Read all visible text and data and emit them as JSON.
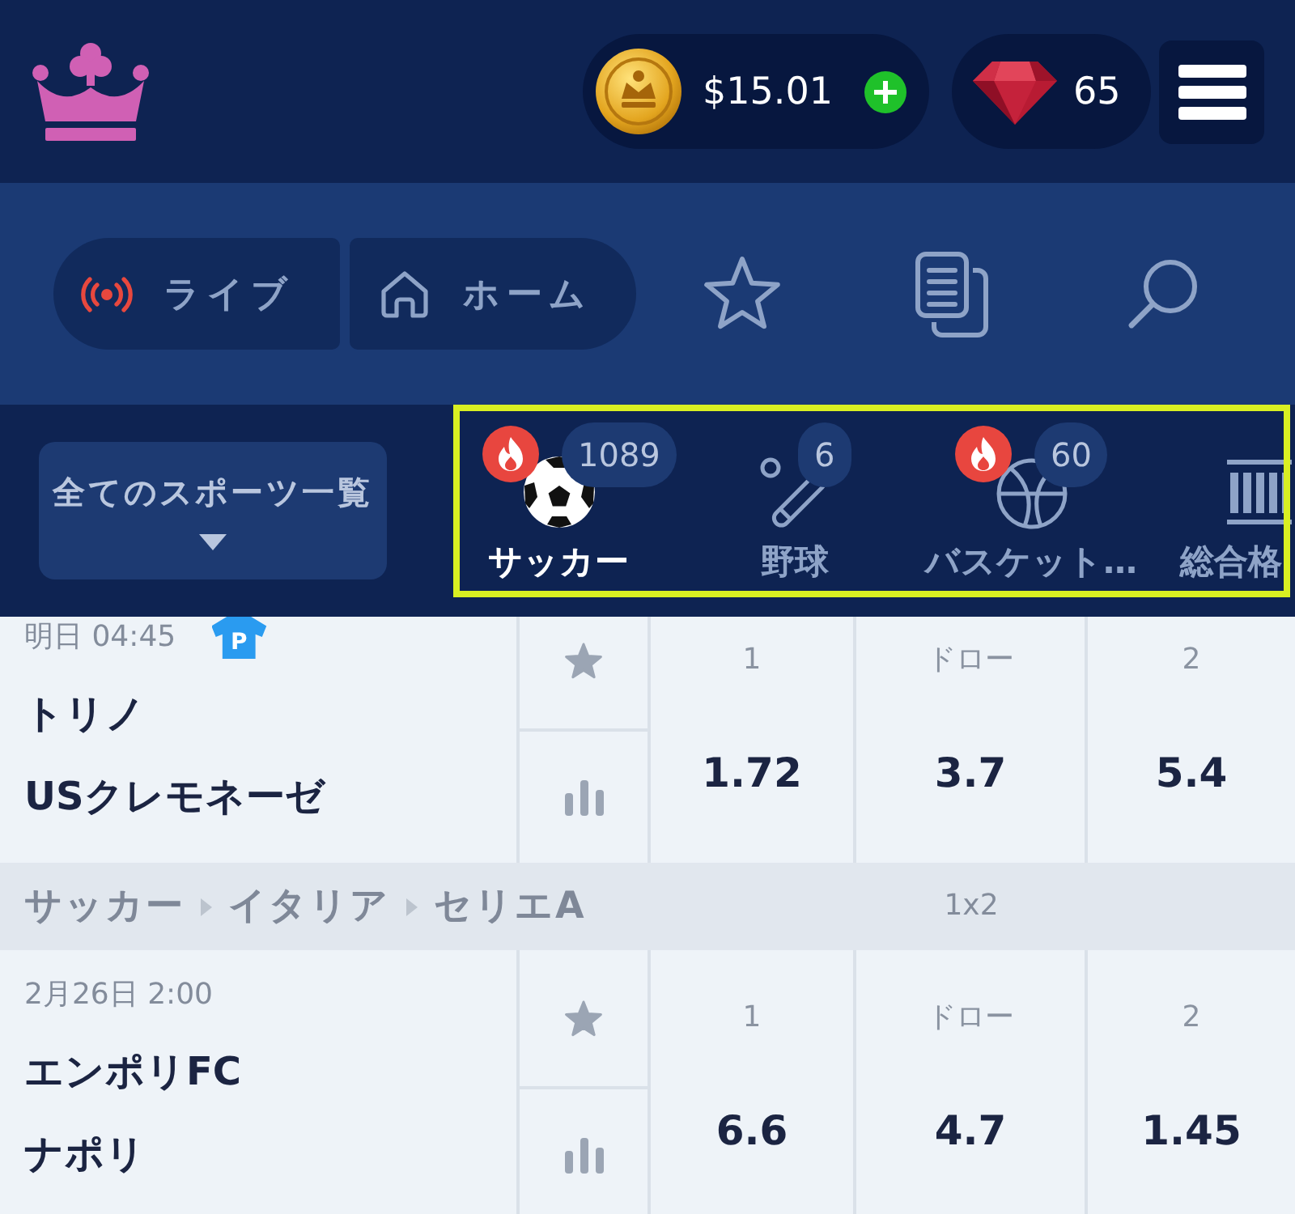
{
  "header": {
    "balance": "$15.01",
    "gems": "65"
  },
  "nav": {
    "tabs": [
      {
        "kind": "live",
        "label": "ライブ",
        "selected": false
      },
      {
        "kind": "home",
        "label": "ホーム",
        "selected": false
      }
    ]
  },
  "sports": {
    "all_label": "全てのスポーツ一覧",
    "items": [
      {
        "kind": "soccer",
        "label": "サッカー",
        "count": "1089",
        "hot": true,
        "selected": true
      },
      {
        "kind": "baseball",
        "label": "野球",
        "count": "6",
        "hot": false,
        "selected": false
      },
      {
        "kind": "basketball",
        "label": "バスケット…",
        "count": "60",
        "hot": true,
        "selected": false
      },
      {
        "kind": "mma",
        "label": "総合格",
        "hot": false,
        "selected": false
      }
    ]
  },
  "events": [
    {
      "kind": "match",
      "date": "明日 04:45",
      "tag": "P",
      "teams": [
        "トリノ",
        "USクレモネーゼ"
      ],
      "favorite": false,
      "odds": [
        {
          "label": "1",
          "value": "1.72"
        },
        {
          "label": "ドロー",
          "value": "3.7"
        },
        {
          "label": "2",
          "value": "5.4"
        }
      ]
    },
    {
      "kind": "league",
      "path": [
        "サッカー",
        "イタリア",
        "セリエA"
      ],
      "market": "1x2"
    },
    {
      "kind": "match",
      "date": "2月26日 2:00",
      "teams": [
        "エンポリFC",
        "ナポリ"
      ],
      "favorite": false,
      "odds": [
        {
          "label": "1",
          "value": "6.6"
        },
        {
          "label": "ドロー",
          "value": "4.7"
        },
        {
          "label": "2",
          "value": "1.45"
        }
      ]
    }
  ]
}
